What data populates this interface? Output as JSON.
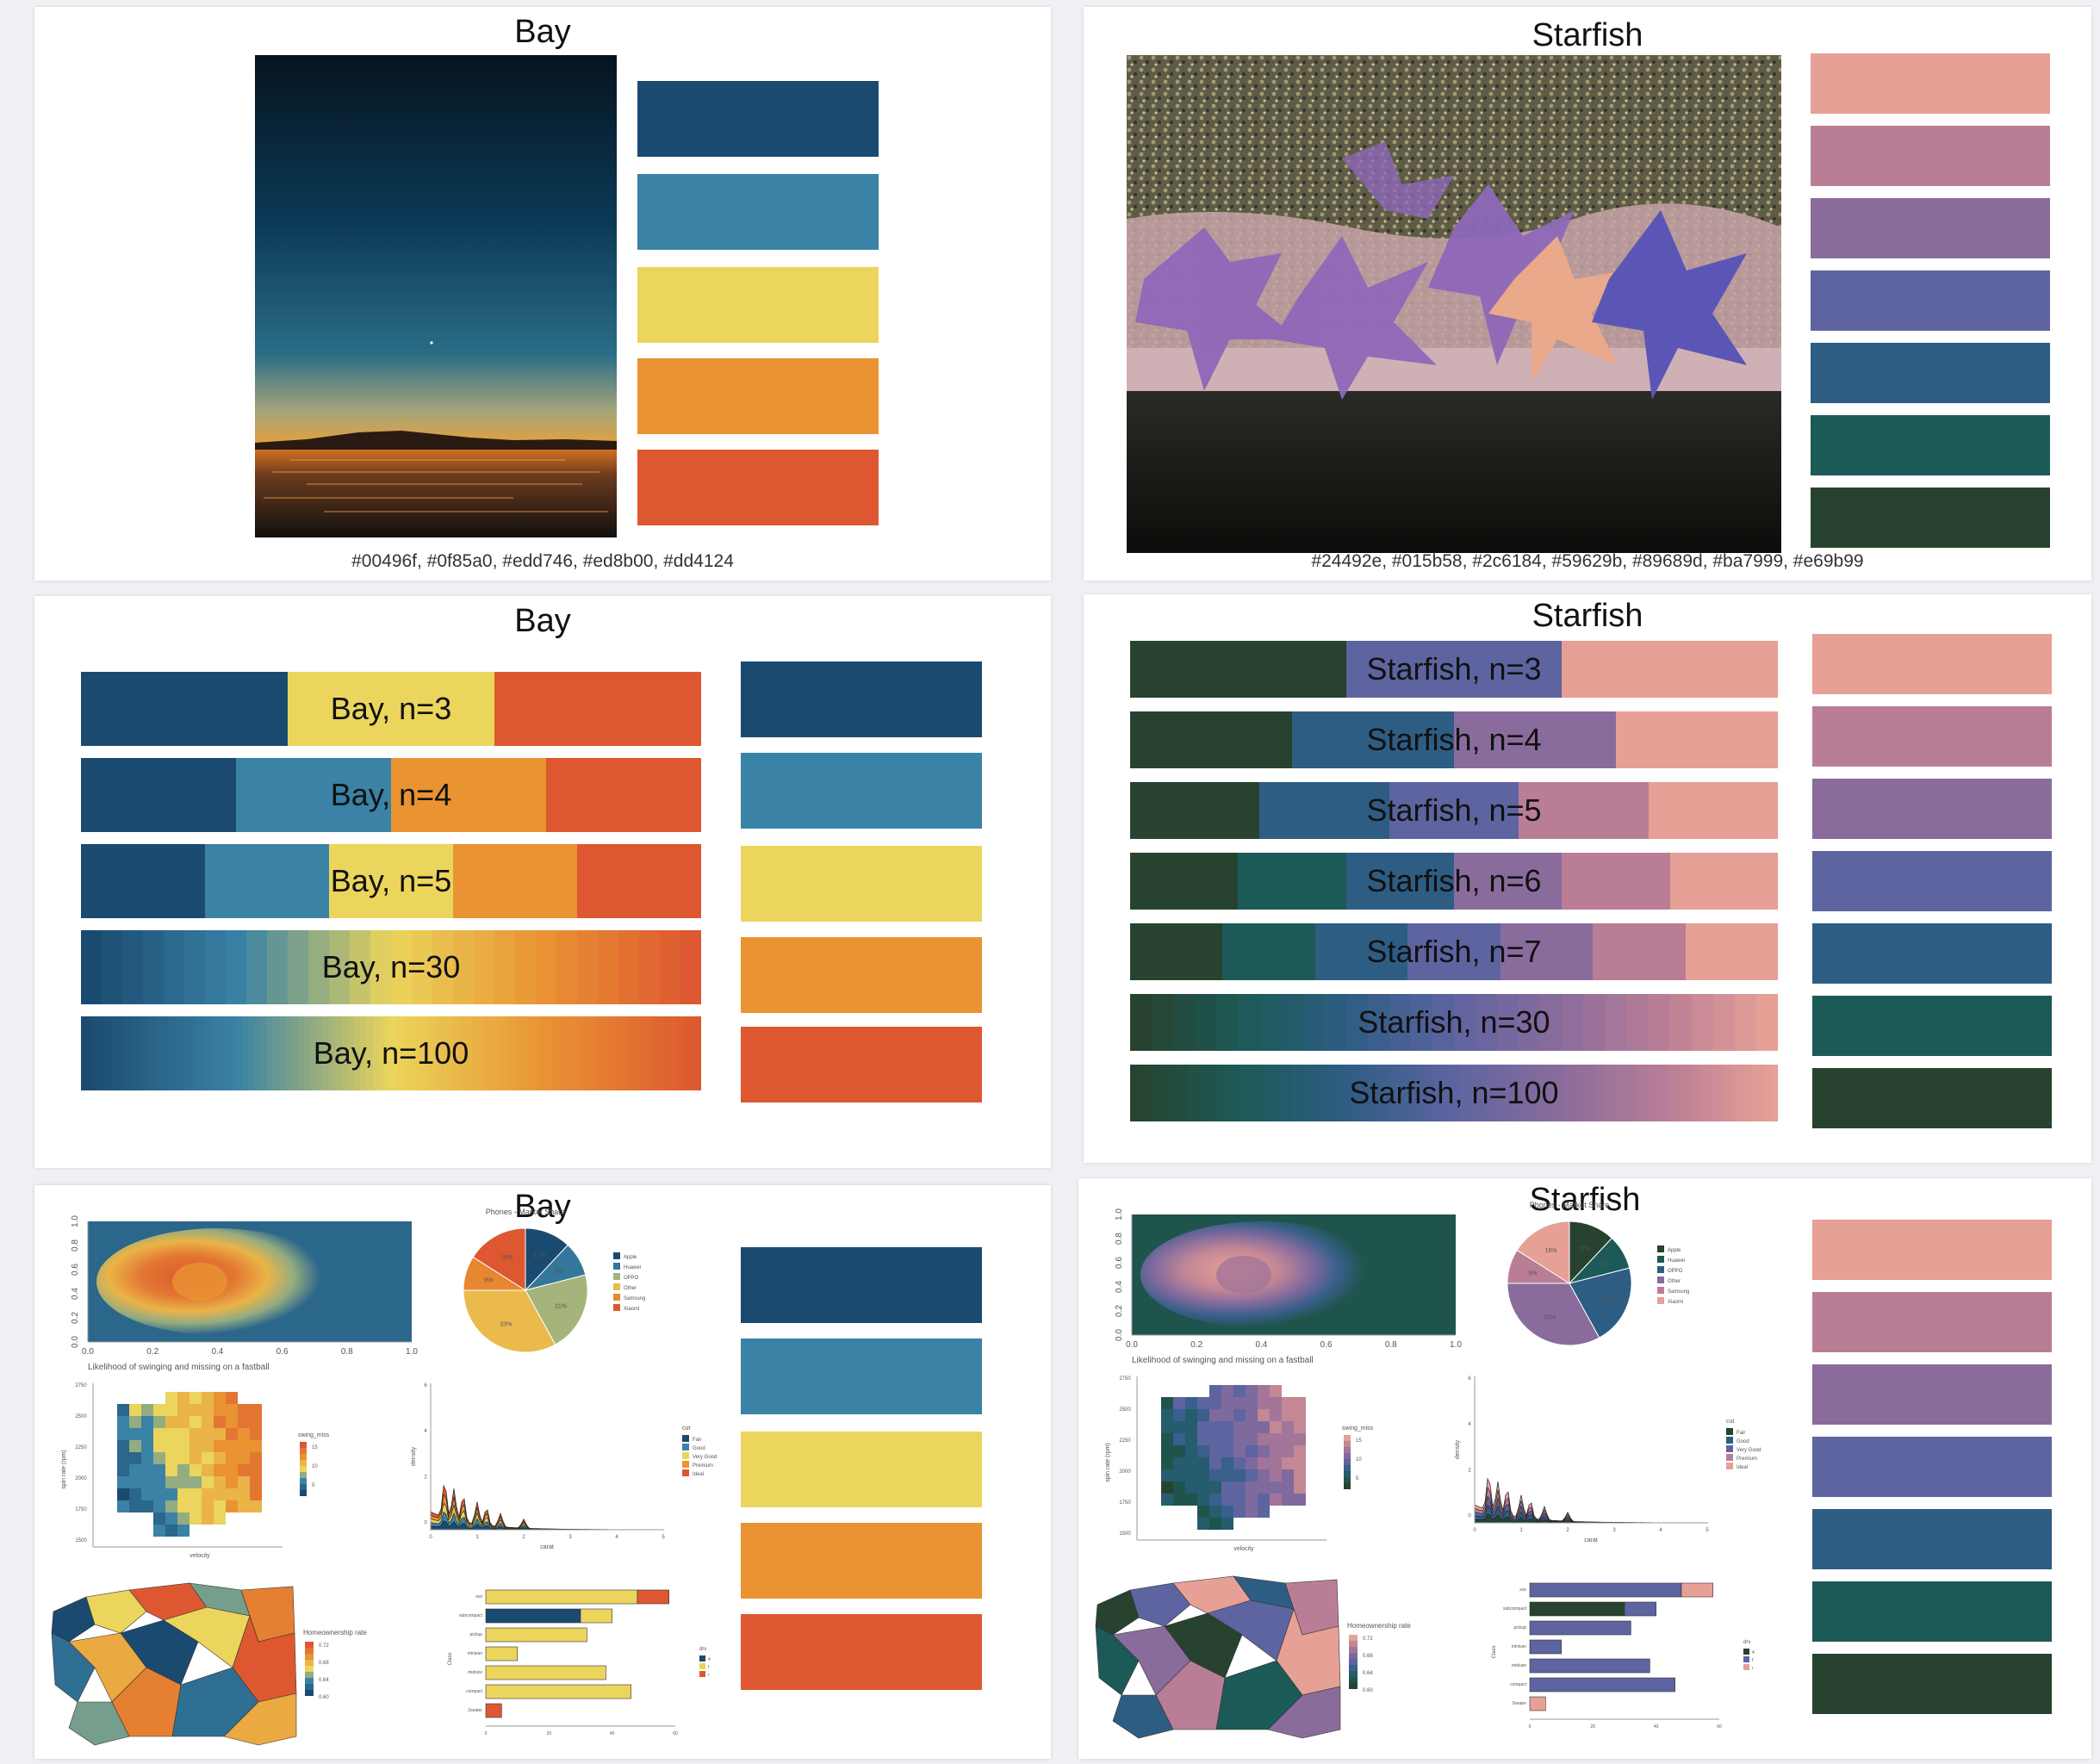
{
  "bay": {
    "name": "Bay",
    "colors": [
      "#00496f",
      "#0f85a0",
      "#edd746",
      "#ed8b00",
      "#dd4124"
    ],
    "swatch_display": [
      "#1b4a70",
      "#3a82a6",
      "#ebd55c",
      "#e99333",
      "#dd5830"
    ],
    "hex_caption": "#00496f, #0f85a0, #edd746, #ed8b00, #dd4124",
    "bars": [
      {
        "label": "Bay, n=3",
        "n": 3
      },
      {
        "label": "Bay, n=4",
        "n": 4
      },
      {
        "label": "Bay, n=5",
        "n": 5
      },
      {
        "label": "Bay, n=30",
        "n": 30
      },
      {
        "label": "Bay, n=100",
        "n": 100
      }
    ]
  },
  "starfish": {
    "name": "Starfish",
    "colors": [
      "#24492e",
      "#015b58",
      "#2c6184",
      "#59629b",
      "#89689d",
      "#ba7999",
      "#e69b99"
    ],
    "swatch_display": [
      "#e6a095",
      "#b97e96",
      "#8a6c9c",
      "#5d64a0",
      "#2e5d84",
      "#1c5a57",
      "#27432f"
    ],
    "hex_caption": "#24492e, #015b58, #2c6184, #59629b, #89689d, #ba7999, #e69b99",
    "bars": [
      {
        "label": "Starfish, n=3",
        "n": 3
      },
      {
        "label": "Starfish, n=4",
        "n": 4
      },
      {
        "label": "Starfish, n=5",
        "n": 5
      },
      {
        "label": "Starfish, n=6",
        "n": 6
      },
      {
        "label": "Starfish, n=7",
        "n": 7
      },
      {
        "label": "Starfish, n=30",
        "n": 30
      },
      {
        "label": "Starfish, n=100",
        "n": 100
      }
    ]
  },
  "example_plots": {
    "heatmap": {
      "xticks": [
        "0.0",
        "0.2",
        "0.4",
        "0.6",
        "0.8",
        "1.0"
      ],
      "yticks": [
        "0.0",
        "0.2",
        "0.4",
        "0.6",
        "0.8",
        "1.0"
      ],
      "caption": "Likelihood of swinging and missing on a fastball"
    },
    "pie": {
      "title": "Phones - Market Share",
      "slices": [
        {
          "name": "Apple",
          "value": 12
        },
        {
          "name": "Huawei",
          "value": 9
        },
        {
          "name": "OPPO",
          "value": 21
        },
        {
          "name": "Other",
          "value": 33
        },
        {
          "name": "Samsung",
          "value": 9
        },
        {
          "name": "Xiaomi",
          "value": 16
        }
      ],
      "slice_labels": [
        "12%",
        "9%",
        "21%",
        "33%",
        "9%",
        "16%"
      ]
    },
    "tile": {
      "ylabel": "spin rate (rpm)",
      "xlabel": "velocity",
      "yticks": [
        "2750",
        "2500",
        "2250",
        "2000",
        "1750",
        "1500"
      ],
      "legend_title": "swing_miss",
      "legend_ticks": [
        "15",
        "10",
        "5"
      ]
    },
    "density": {
      "ylabel": "density",
      "xlabel": "carat",
      "xticks": [
        "0",
        "1",
        "2",
        "3",
        "4",
        "5"
      ],
      "yticks": [
        "6",
        "4",
        "2",
        "0"
      ],
      "legend_title": "cut",
      "legend_items": [
        "Fair",
        "Good",
        "Very Good",
        "Premium",
        "Ideal"
      ]
    },
    "map": {
      "legend_title": "Homeownership rate",
      "legend_ticks": [
        "0.72",
        "0.68",
        "0.64",
        "0.60"
      ]
    },
    "hbar": {
      "ylabel": "Class",
      "categories": [
        "suv",
        "subcompact",
        "pickup",
        "minivan",
        "midsize",
        "compact",
        "2seater"
      ],
      "xticks": [
        "0",
        "20",
        "40",
        "60"
      ],
      "legend_title": "drv",
      "legend_items": [
        "4",
        "f",
        "r"
      ]
    }
  }
}
